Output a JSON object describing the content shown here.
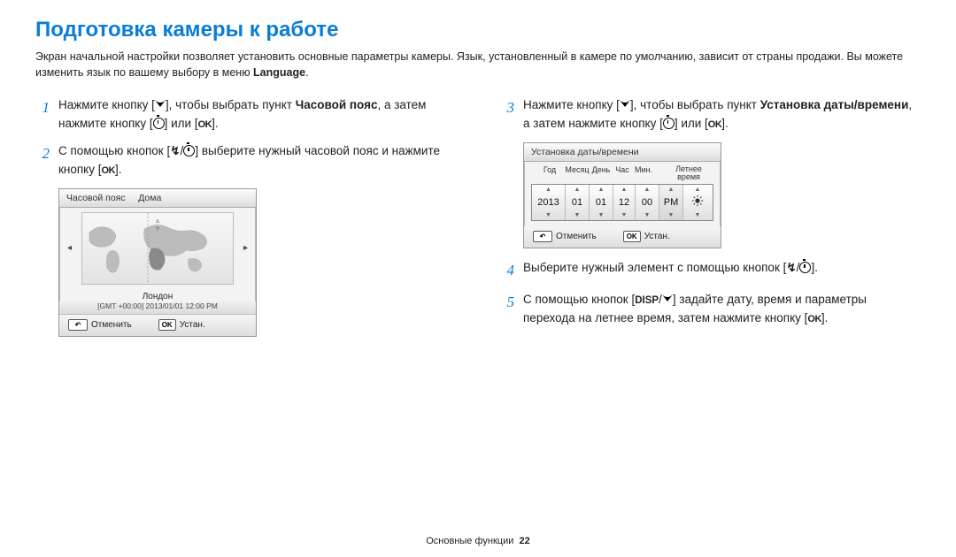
{
  "title": "Подготовка камеры к работе",
  "intro_a": "Экран начальной настройки позволяет установить основные параметры камеры. Язык, установленный в камере по умолчанию, зависит от страны продажи. Вы можете изменить язык по вашему выбору в меню ",
  "intro_lang": "Language",
  "intro_b": ".",
  "steps": {
    "s1a": "Нажмите кнопку [",
    "s1b": "], чтобы выбрать пункт ",
    "s1bold": "Часовой пояс",
    "s1c": ", а затем нажмите кнопку [",
    "s1d": "] или [",
    "s1e": "].",
    "s2a": "С помощью кнопок [",
    "s2b": "/",
    "s2c": "] выберите нужный часовой пояс и нажмите кнопку [",
    "s2d": "].",
    "s3a": "Нажмите кнопку [",
    "s3b": "], чтобы выбрать пункт ",
    "s3bold1": "Установка даты/времени",
    "s3c": ", а затем нажмите кнопку [",
    "s3d": "] или [",
    "s3e": "].",
    "s4a": "Выберите нужный элемент с помощью кнопок [",
    "s4b": "/",
    "s4c": "].",
    "s5a": "С помощью кнопок [",
    "s5b": "/",
    "s5c": "] задайте дату, время и параметры перехода на летнее время, затем нажмите кнопку [",
    "s5d": "]."
  },
  "ok": "OK",
  "disp": "DISP",
  "tz_panel": {
    "title_label": "Часовой пояс",
    "title_value": "Дома",
    "city": "Лондон",
    "gmt": "[GMT +00:00] 2013/01/01 12:00 PM",
    "cancel": "Отменить",
    "set": "Устан."
  },
  "date_panel": {
    "title": "Установка даты/времени",
    "labels": {
      "year": "Год",
      "month": "Месяц",
      "day": "День",
      "hour": "Час",
      "min": "Мин.",
      "dst": "Летнее время"
    },
    "values": {
      "year": "2013",
      "month": "01",
      "day": "01",
      "hour": "12",
      "min": "00",
      "pm": "PM"
    },
    "cancel": "Отменить",
    "set": "Устан."
  },
  "footer_label": "Основные функции",
  "footer_page": "22"
}
